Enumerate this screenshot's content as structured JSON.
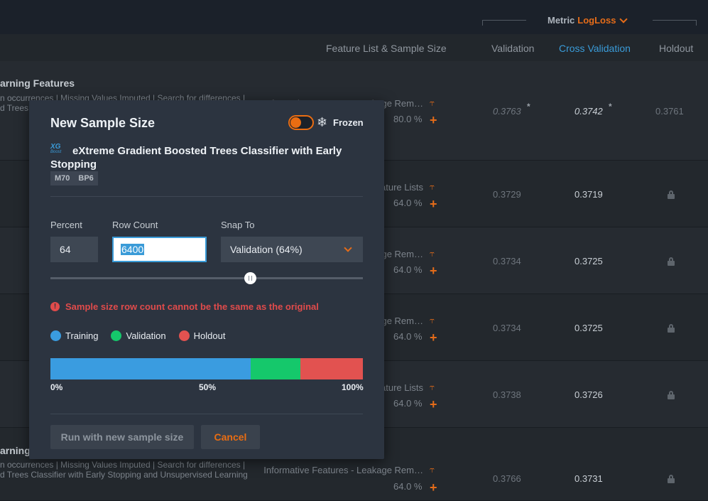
{
  "header": {
    "metric_label": "Metric",
    "metric_value": "LogLoss"
  },
  "columns": {
    "feature_list": "Feature List & Sample Size",
    "validation": "Validation",
    "cross_validation": "Cross Validation",
    "holdout": "Holdout"
  },
  "rows": [
    {
      "title": "arning Features",
      "sub1": "n occurrences | Missing Values Imputed | Search for differences |",
      "sub2": "d Trees",
      "feature_list": "Informative Features - Leakage Rem…",
      "pct": "80.0 %",
      "validation": "0.3763",
      "cv": "0.3742",
      "holdout": "0.3761"
    },
    {
      "feature_list": "Feature Lists",
      "pct": "64.0 %",
      "validation": "0.3729",
      "cv": "0.3719"
    },
    {
      "feature_list": "Leakage Rem…",
      "pct": "64.0 %",
      "validation": "0.3734",
      "cv": "0.3725"
    },
    {
      "feature_list": "Leakage Rem…",
      "pct": "64.0 %",
      "validation": "0.3734",
      "cv": "0.3725"
    },
    {
      "feature_list": "Feature Lists",
      "pct": "64.0 %",
      "validation": "0.3738",
      "cv": "0.3726"
    },
    {
      "title": "arning",
      "sub1": "n occurrences | Missing Values Imputed | Search for differences |",
      "sub2": "d Trees Classifier with Early Stopping and Unsupervised Learning",
      "feature_list": "Informative Features - Leakage Rem…",
      "pct": "64.0 %",
      "validation": "0.3766",
      "cv": "0.3731"
    }
  ],
  "modal": {
    "title": "New Sample Size",
    "frozen_label": "Frozen",
    "model_logo_top": "XG",
    "model_logo_bottom": "Boost",
    "model_name": "eXtreme Gradient Boosted Trees Classifier with Early Stopping",
    "badges": [
      "M70",
      "BP6"
    ],
    "percent_label": "Percent",
    "percent_value": "64",
    "row_count_label": "Row Count",
    "row_count_value": "6400",
    "snap_label": "Snap To",
    "snap_value": "Validation (64%)",
    "slider_value": 64,
    "error_text": "Sample size row count cannot be the same as the original",
    "legend": [
      {
        "name": "Training",
        "color": "#3a9ce0"
      },
      {
        "name": "Validation",
        "color": "#15c86b"
      },
      {
        "name": "Holdout",
        "color": "#e25250"
      }
    ],
    "partition": [
      {
        "name": "Training",
        "percent": 64,
        "color": "#3a9ce0"
      },
      {
        "name": "Validation",
        "percent": 16,
        "color": "#15c86b"
      },
      {
        "name": "Holdout",
        "percent": 20,
        "color": "#e25250"
      }
    ],
    "ticks": [
      "0%",
      "50%",
      "100%"
    ],
    "run_button": "Run with new sample size",
    "cancel_button": "Cancel"
  }
}
